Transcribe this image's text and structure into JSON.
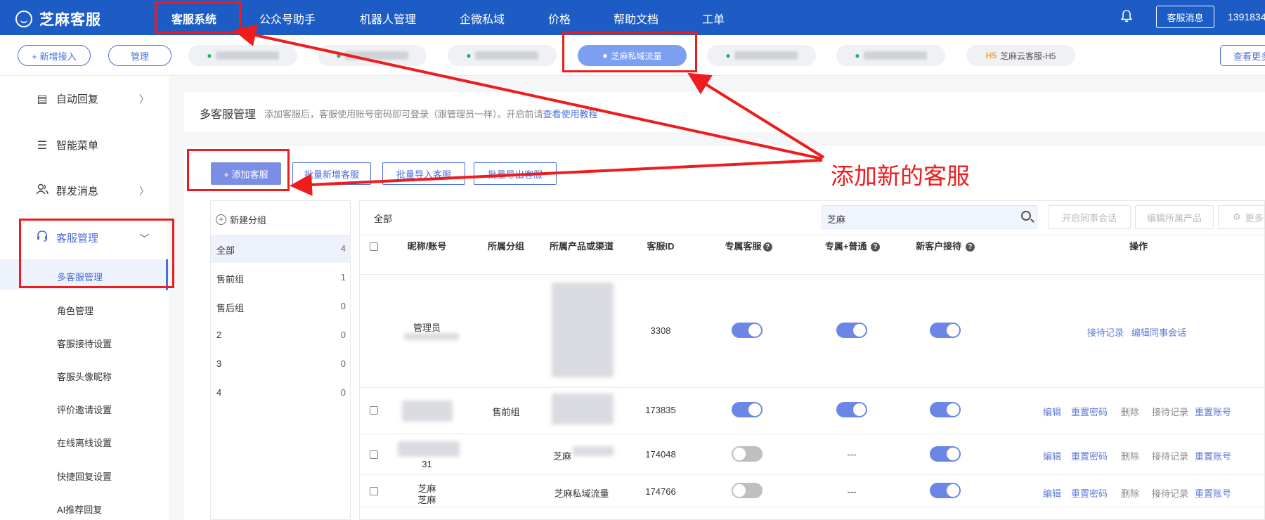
{
  "app": {
    "name": "芝麻客服"
  },
  "topnav": {
    "items": [
      "客服系统",
      "公众号助手",
      "机器人管理",
      "企微私域",
      "价格",
      "帮助文档",
      "工单"
    ],
    "message_button": "客服消息",
    "phone": "1391834"
  },
  "tabs": {
    "add_button": "+ 新增接入",
    "manage_button": "管理",
    "channels": [
      "芝麻私域流量",
      "芝麻云客服-H5"
    ],
    "view_more": "查看更多"
  },
  "sidebar": {
    "items": [
      {
        "label": "自动回复",
        "icon": "auto-reply-icon"
      },
      {
        "label": "智能菜单",
        "icon": "list-icon"
      },
      {
        "label": "群发消息",
        "icon": "users-icon"
      },
      {
        "label": "客服管理",
        "icon": "headset-icon"
      }
    ],
    "subitems": [
      "多客服管理",
      "角色管理",
      "客服接待设置",
      "客服头像昵称",
      "评价邀请设置",
      "在线离线设置",
      "快捷回复设置",
      "AI推荐回复"
    ]
  },
  "page": {
    "title": "多客服管理",
    "description": "添加客服后，客服使用账号密码即可登录（跟管理员一样）。开启前请",
    "help_link": "查看使用教程"
  },
  "actions": {
    "add": "+ 添加客服",
    "batch_add": "批量新增客服",
    "batch_import": "批量导入客服",
    "batch_export": "批量导出客服"
  },
  "groups": {
    "new_group": "新建分组",
    "list": [
      {
        "name": "全部",
        "count": "4"
      },
      {
        "name": "售前组",
        "count": "1"
      },
      {
        "name": "售后组",
        "count": "0"
      },
      {
        "name": "2",
        "count": "0"
      },
      {
        "name": "3",
        "count": "0"
      },
      {
        "name": "4",
        "count": "0"
      }
    ]
  },
  "table": {
    "filter_label": "全部",
    "search_value": "芝麻",
    "buttons": [
      "开启同事会话",
      "编辑所属产品",
      "更多"
    ],
    "headers": [
      "昵称/账号",
      "所属分组",
      "所属产品或渠道",
      "客服ID",
      "专属客服",
      "专属+普通",
      "新客户接待",
      "操作"
    ],
    "rows": [
      {
        "nickname": "管理员",
        "group": "",
        "product": "",
        "id": "3308",
        "exclusive": true,
        "exclusive_normal": "on",
        "new_customer": true,
        "ops": [
          "接待记录",
          "编辑同事会话"
        ]
      },
      {
        "nickname": "",
        "group": "售前组",
        "product": "",
        "id": "173835",
        "exclusive": true,
        "exclusive_normal": "on",
        "new_customer": true,
        "ops": [
          "编辑",
          "重置密码",
          "删除",
          "接待记录",
          "重置账号"
        ]
      },
      {
        "nickname": "31",
        "group": "",
        "product": "芝麻",
        "id": "174048",
        "exclusive": false,
        "exclusive_normal": "---",
        "new_customer": true,
        "ops": [
          "编辑",
          "重置密码",
          "删除",
          "接待记录",
          "重置账号"
        ]
      },
      {
        "nickname": "芝麻",
        "nickname2": "芝麻",
        "group": "",
        "product": "芝麻私域流量",
        "id": "174766",
        "exclusive": false,
        "exclusive_normal": "---",
        "new_customer": true,
        "ops": [
          "编辑",
          "重置密码",
          "删除",
          "接待记录",
          "重置账号"
        ]
      }
    ]
  },
  "annotation": {
    "text": "添加新的客服",
    "color": "#ee1c1c"
  },
  "colors": {
    "nav": "#1d5cc4",
    "accent": "#4a6fd8",
    "toggle_on": "#6b86e6",
    "toggle_off": "#bfbfbf"
  }
}
